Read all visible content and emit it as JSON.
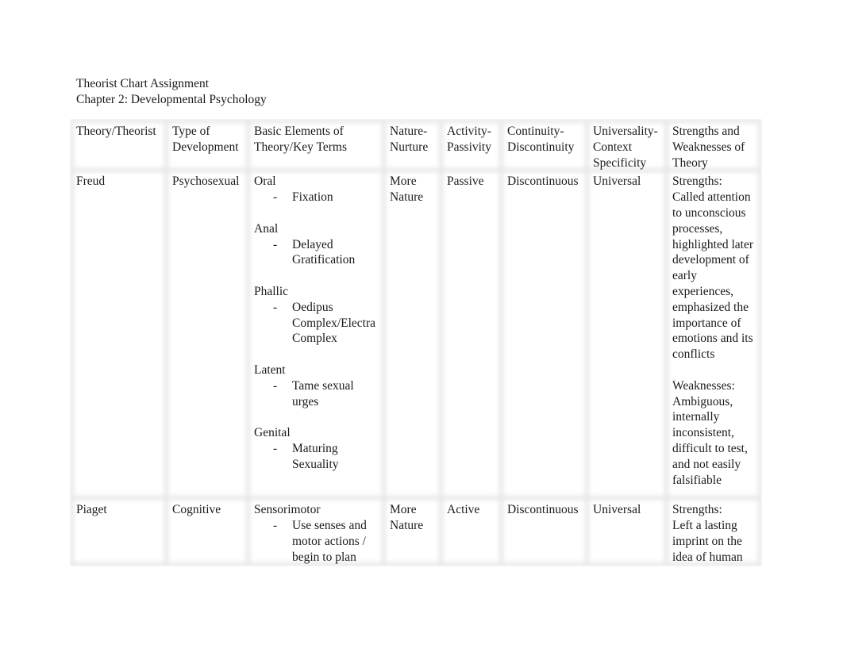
{
  "document": {
    "title": "Theorist Chart Assignment",
    "subtitle": "Chapter 2: Developmental Psychology"
  },
  "table": {
    "headers": [
      "Theory/Theorist",
      "Type of Development",
      "Basic Elements of Theory/Key Terms",
      "Nature-Nurture",
      "Activity-Passivity",
      "Continuity-Discontinuity",
      "Universality-Context Specificity",
      "Strengths and Weaknesses of Theory"
    ],
    "rows": [
      {
        "theorist": "Freud",
        "type": "Psychosexual",
        "elements": [
          {
            "stage": "Oral",
            "term": "Fixation"
          },
          {
            "stage": "Anal",
            "term": "Delayed Gratification"
          },
          {
            "stage": "Phallic",
            "term": "Oedipus Complex/Electra Complex"
          },
          {
            "stage": "Latent",
            "term": "Tame sexual urges"
          },
          {
            "stage": "Genital",
            "term": "Maturing Sexuality"
          }
        ],
        "nature_nurture": "More Nature",
        "activity_passivity": "Passive",
        "continuity": "Discontinuous",
        "universality": "Universal",
        "strengths_label": "Strengths:",
        "strengths": "Called attention to unconscious processes, highlighted later development of early experiences, emphasized the importance of emotions and its conflicts",
        "weaknesses_label": "Weaknesses:",
        "weaknesses": "Ambiguous, internally inconsistent, difficult to test, and not easily falsifiable"
      },
      {
        "theorist": "Piaget",
        "type": "Cognitive",
        "elements": [
          {
            "stage": "Sensorimotor",
            "term": "Use senses and motor actions / begin to plan"
          }
        ],
        "nature_nurture": "More Nature",
        "activity_passivity": "Active",
        "continuity": "Discontinuous",
        "universality": "Universal",
        "strengths_label": "Strengths:",
        "strengths": "Left a lasting imprint on the idea of human"
      }
    ],
    "bullet": "-"
  }
}
